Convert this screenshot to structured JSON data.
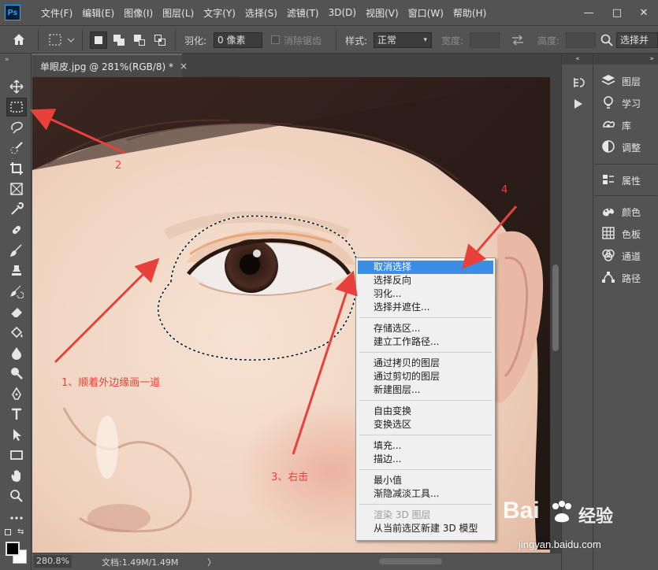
{
  "app": {
    "logo_text": "Ps"
  },
  "menubar": {
    "items": [
      "文件(F)",
      "编辑(E)",
      "图像(I)",
      "图层(L)",
      "文字(Y)",
      "选择(S)",
      "滤镜(T)",
      "3D(D)",
      "视图(V)",
      "窗口(W)",
      "帮助(H)"
    ],
    "window_controls": {
      "minimize": "—",
      "maximize": "□",
      "close": "✕"
    }
  },
  "options_bar": {
    "feather_label": "羽化:",
    "feather_value": "0 像素",
    "antialias_label": "消除锯齿",
    "style_label": "样式:",
    "style_value": "正常",
    "width_label": "宽度:",
    "height_label": "高度:",
    "select_mask_label": "选择并"
  },
  "document": {
    "tab_title": "单眼皮.jpg @ 281%(RGB/8) *",
    "tab_close": "×"
  },
  "status_bar": {
    "zoom": "280.8%",
    "doc_size": "文档:1.49M/1.49M",
    "arrow": "〉"
  },
  "toolbar": {
    "tools": [
      "move-tool",
      "marquee-tool",
      "lasso-tool",
      "quick-selection-tool",
      "crop-tool",
      "frame-tool",
      "eyedropper-tool",
      "healing-brush-tool",
      "brush-tool",
      "clone-stamp-tool",
      "history-brush-tool",
      "eraser-tool",
      "paint-bucket-tool",
      "blur-tool",
      "dodge-tool",
      "pen-tool",
      "type-tool",
      "path-selection-tool",
      "rectangle-tool",
      "hand-tool",
      "zoom-tool",
      "more-tools"
    ],
    "foreground_color": "#000000",
    "background_color": "#ffffff"
  },
  "dock": {
    "collapse_label": "»",
    "groups": [
      [
        {
          "label": "图层",
          "icon": "layers-icon"
        },
        {
          "label": "学习",
          "icon": "learn-icon"
        },
        {
          "label": "库",
          "icon": "libraries-icon"
        },
        {
          "label": "调整",
          "icon": "adjustments-icon"
        }
      ],
      [
        {
          "label": "属性",
          "icon": "properties-icon"
        }
      ],
      [
        {
          "label": "颜色",
          "icon": "color-icon"
        },
        {
          "label": "色板",
          "icon": "swatches-icon"
        },
        {
          "label": "通道",
          "icon": "channels-icon"
        },
        {
          "label": "路径",
          "icon": "paths-icon"
        }
      ]
    ]
  },
  "context_menu": {
    "groups": [
      [
        "取消选择",
        "选择反向",
        "羽化...",
        "选择并遮住..."
      ],
      [
        "存储选区...",
        "建立工作路径..."
      ],
      [
        "通过拷贝的图层",
        "通过剪切的图层",
        "新建图层..."
      ],
      [
        "自由变换",
        "变换选区"
      ],
      [
        "填充...",
        "描边..."
      ],
      [
        "最小值",
        "渐隐减淡工具..."
      ],
      [
        "渲染 3D 图层",
        "从当前选区新建 3D 模型"
      ]
    ],
    "highlighted": "取消选择",
    "disabled": [
      "渲染 3D 图层"
    ]
  },
  "annotations": {
    "step1": "1、顺着外边缘画一道",
    "step2": "2",
    "step3": "3、右击",
    "step4": "4",
    "color": "#e8413c"
  },
  "watermark": {
    "brand": "Bai",
    "brand_suffix": "经验",
    "url": "jingyan.baidu.com"
  },
  "colors": {
    "ui_bg": "#535353",
    "highlight": "#3a8ee6",
    "accent": "#31a8ff"
  }
}
